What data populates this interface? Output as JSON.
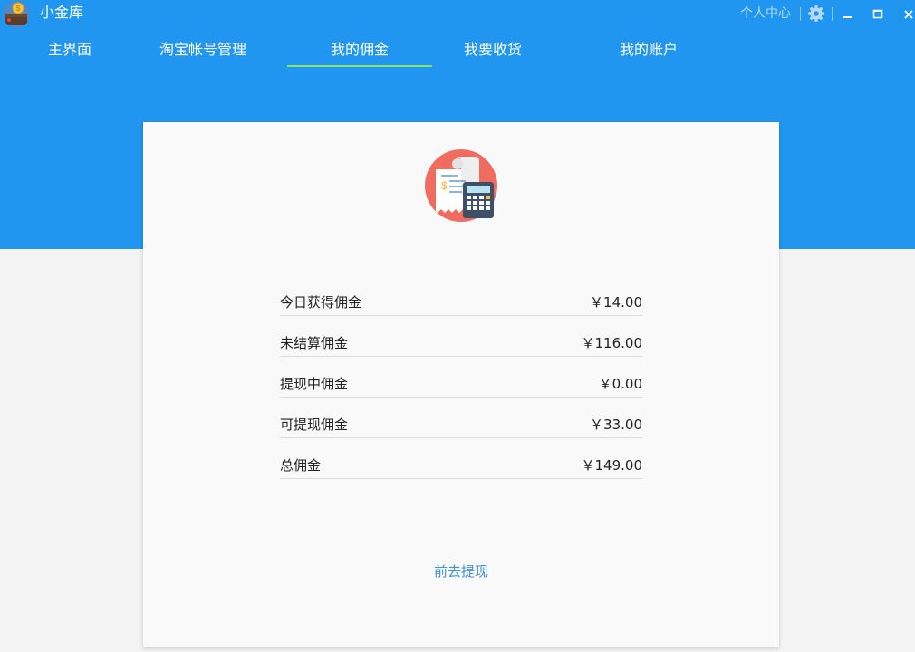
{
  "app": {
    "title": "小金库",
    "logo_icon": "coin-wallet-icon"
  },
  "titlebar": {
    "personal_center": "个人中心",
    "settings_icon": "gear-icon",
    "minimize_icon": "minimize-icon",
    "maximize_icon": "maximize-icon",
    "close_icon": "close-icon"
  },
  "nav": {
    "tabs": [
      {
        "label": "主界面"
      },
      {
        "label": "淘宝帐号管理"
      },
      {
        "label": "我的佣金",
        "active": true
      },
      {
        "label": "我要收货"
      },
      {
        "label": "我的账户"
      }
    ]
  },
  "commission": {
    "hero_icon": "receipt-calculator-icon",
    "rows": [
      {
        "label": "今日获得佣金",
        "value": "￥14.00"
      },
      {
        "label": "未结算佣金",
        "value": "￥116.00"
      },
      {
        "label": "提现中佣金",
        "value": "￥0.00"
      },
      {
        "label": "可提现佣金",
        "value": "￥33.00"
      },
      {
        "label": "总佣金",
        "value": "￥149.00"
      }
    ],
    "withdraw_link": "前去提现"
  },
  "colors": {
    "header": "#2196f0",
    "active_tab_underline": "#8be26a",
    "link": "#3d8fd8",
    "page_background": "#f3f3f3",
    "card_background": "#f9f9f9"
  }
}
